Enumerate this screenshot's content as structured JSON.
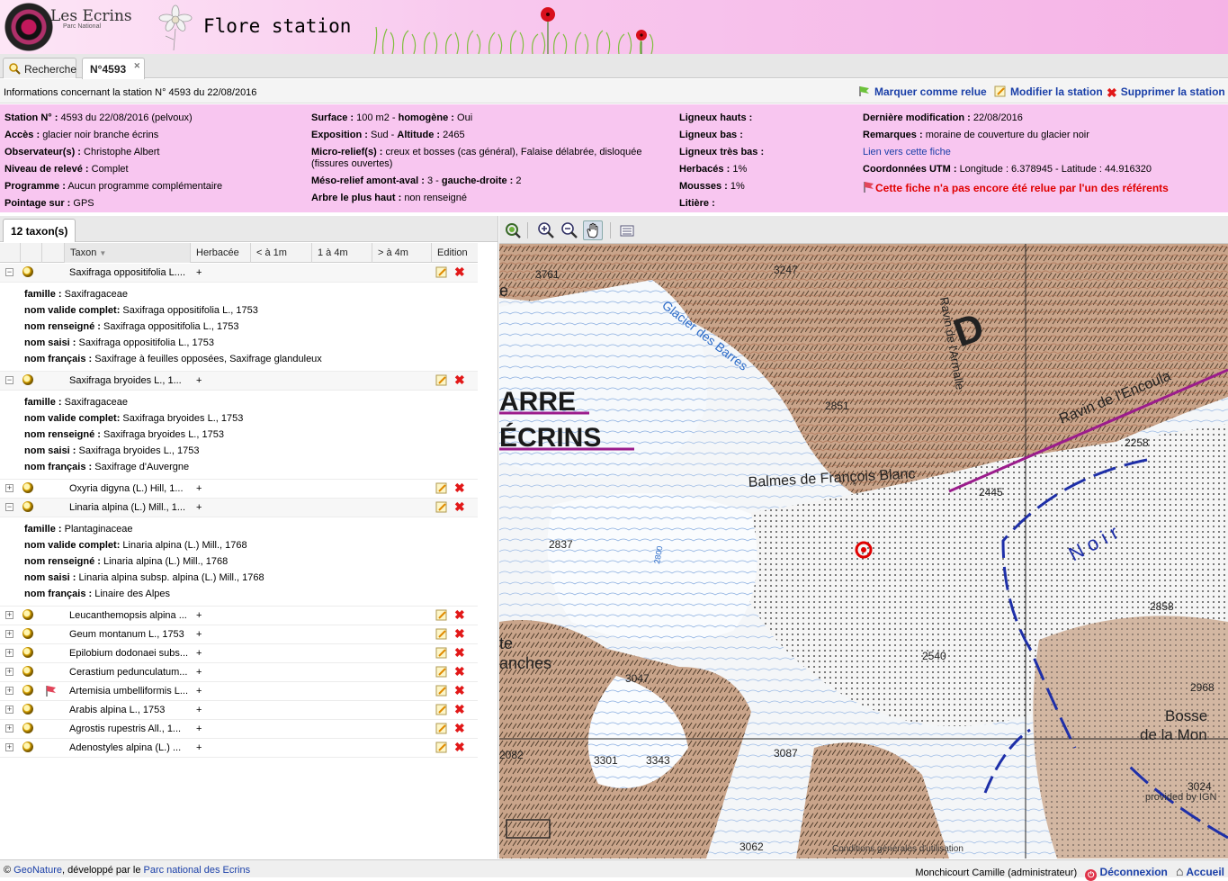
{
  "header": {
    "logo_text": "Les Ecrins",
    "logo_sub": "Parc National",
    "title": "Flore station"
  },
  "tabs": [
    {
      "label": "Recherche"
    },
    {
      "label": "N°4593"
    }
  ],
  "infobar": {
    "title": "Informations concernant la station N° 4593 du 22/08/2016",
    "actions": {
      "mark": "Marquer comme relue",
      "edit": "Modifier la station",
      "delete": "Supprimer la station"
    }
  },
  "details": {
    "col1": [
      {
        "label": "Station N° :",
        "value": "4593 du 22/08/2016 (pelvoux)"
      },
      {
        "label": "Accès :",
        "value": "glacier noir branche écrins"
      },
      {
        "label": "Observateur(s) :",
        "value": "Christophe Albert"
      },
      {
        "label": "Niveau de relevé :",
        "value": "Complet"
      },
      {
        "label": "Programme :",
        "value": "Aucun programme complémentaire"
      },
      {
        "label": "Pointage sur :",
        "value": "GPS"
      }
    ],
    "col2": [
      {
        "label": "Surface :",
        "value": "100 m2 - ",
        "label2": "homogène :",
        "value2": "Oui"
      },
      {
        "label": "Exposition :",
        "value": "Sud - ",
        "label2": "Altitude :",
        "value2": "2465"
      },
      {
        "label": "Micro-relief(s) :",
        "value": "creux et bosses (cas général), Falaise délabrée, disloquée (fissures ouvertes)"
      },
      {
        "label": "Méso-relief amont-aval :",
        "value": "3 - ",
        "label2": "gauche-droite :",
        "value2": "2"
      },
      {
        "label": "Arbre le plus haut :",
        "value": "non renseigné"
      }
    ],
    "col3": [
      {
        "label": "Ligneux hauts :",
        "value": ""
      },
      {
        "label": "Ligneux bas :",
        "value": ""
      },
      {
        "label": "Ligneux très bas :",
        "value": ""
      },
      {
        "label": "Herbacés :",
        "value": "1%"
      },
      {
        "label": "Mousses :",
        "value": "1%"
      },
      {
        "label": "Litière :",
        "value": ""
      }
    ],
    "col4": {
      "last_mod_label": "Dernière modification :",
      "last_mod_value": "22/08/2016",
      "remarks_label": "Remarques :",
      "remarks_value": "moraine de couverture du glacier noir",
      "link": "Lien vers cette fiche",
      "utm_label": "Coordonnées UTM :",
      "utm_value": "Longitude : 6.378945 - Latitude : 44.916320",
      "warning": "Cette fiche n'a pas encore été relue par l'un des référents",
      "warning_color": "#e00000"
    }
  },
  "grid": {
    "tab_label": "12 taxon(s)",
    "columns": [
      "Taxon",
      "Herbacée",
      "< à 1m",
      "1 à 4m",
      "> à 4m",
      "Edition"
    ],
    "detail_labels": {
      "famille": "famille :",
      "valide": "nom valide complet:",
      "renseigne": "nom renseigné :",
      "saisi": "nom saisi :",
      "francais": "nom français :"
    },
    "rows": [
      {
        "taxon": "Saxifraga oppositifolia L....",
        "herbacee": "+",
        "expanded": true,
        "pm": "−",
        "famille": "Saxifragaceae",
        "valide": "Saxifraga oppositifolia L., 1753",
        "renseigne": "Saxifraga oppositifolia L., 1753",
        "saisi": "Saxifraga oppositifolia L., 1753",
        "francais": "Saxifrage à feuilles opposées, Saxifrage glanduleux"
      },
      {
        "taxon": "Saxifraga bryoides L., 1...",
        "herbacee": "+",
        "expanded": true,
        "pm": "−",
        "famille": "Saxifragaceae",
        "valide": "Saxifraga bryoides L., 1753",
        "renseigne": "Saxifraga bryoides L., 1753",
        "saisi": "Saxifraga bryoides L., 1753",
        "francais": "Saxifrage d'Auvergne"
      },
      {
        "taxon": "Oxyria digyna (L.) Hill, 1...",
        "herbacee": "+",
        "expanded": false,
        "pm": "+"
      },
      {
        "taxon": "Linaria alpina (L.) Mill., 1...",
        "herbacee": "+",
        "expanded": true,
        "pm": "−",
        "famille": "Plantaginaceae",
        "valide": "Linaria alpina (L.) Mill., 1768",
        "renseigne": "Linaria alpina (L.) Mill., 1768",
        "saisi": "Linaria alpina subsp. alpina (L.) Mill., 1768",
        "francais": "Linaire des Alpes"
      },
      {
        "taxon": "Leucanthemopsis alpina ...",
        "herbacee": "+",
        "expanded": false,
        "pm": "+"
      },
      {
        "taxon": "Geum montanum L., 1753",
        "herbacee": "+",
        "expanded": false,
        "pm": "+"
      },
      {
        "taxon": "Epilobium dodonaei subs...",
        "herbacee": "+",
        "expanded": false,
        "pm": "+"
      },
      {
        "taxon": "Cerastium pedunculatum...",
        "herbacee": "+",
        "expanded": false,
        "pm": "+"
      },
      {
        "taxon": "Artemisia umbelliformis L...",
        "herbacee": "+",
        "expanded": false,
        "pm": "+",
        "flag": true
      },
      {
        "taxon": "Arabis alpina L., 1753",
        "herbacee": "+",
        "expanded": false,
        "pm": "+"
      },
      {
        "taxon": "Agrostis rupestris All., 1...",
        "herbacee": "+",
        "expanded": false,
        "pm": "+"
      },
      {
        "taxon": "Adenostyles alpina (L.) ...",
        "herbacee": "+",
        "expanded": false,
        "pm": "+"
      }
    ]
  },
  "map": {
    "labels": {
      "peak_3761": "3761",
      "peak_3247": "3247",
      "glacier_barres": "Glacier des Barres",
      "barre": "ARRE",
      "ecrins": "ÉCRINS",
      "peak_2851": "2851",
      "armalle": "Ravin de l'Armalle",
      "letter_d": "D",
      "encoula": "Ravin de l'Encoula",
      "peak_2258": "2258",
      "balmes": "Balmes de François Blanc",
      "peak_2445": "2445",
      "peak_2837": "2837",
      "peak_2540": "2540",
      "peak_2858": "2858",
      "peak_3047": "3047",
      "peak_3301": "3301",
      "peak_3343": "3343",
      "peak_3087": "3087",
      "peak_3062": "3062",
      "peak_2968": "2968",
      "bosse": "Bosse",
      "de_la_mon": "de la Mon",
      "peak_3024": "3024",
      "noir": "N o i r",
      "te": "te",
      "anches": "anches",
      "e_left": "e",
      "peak_2800": "2800",
      "peak_2082": "2082",
      "attribution": "Conditions générales d'utilisation",
      "provided": "provided by IGN"
    }
  },
  "footer": {
    "left_prefix": "© ",
    "left_link1": "GeoNature",
    "left_mid": ", développé par le ",
    "left_link2": "Parc national des Ecrins",
    "user": "Monchicourt Camille (administrateur)",
    "logout": "Déconnexion",
    "home": "Accueil"
  }
}
